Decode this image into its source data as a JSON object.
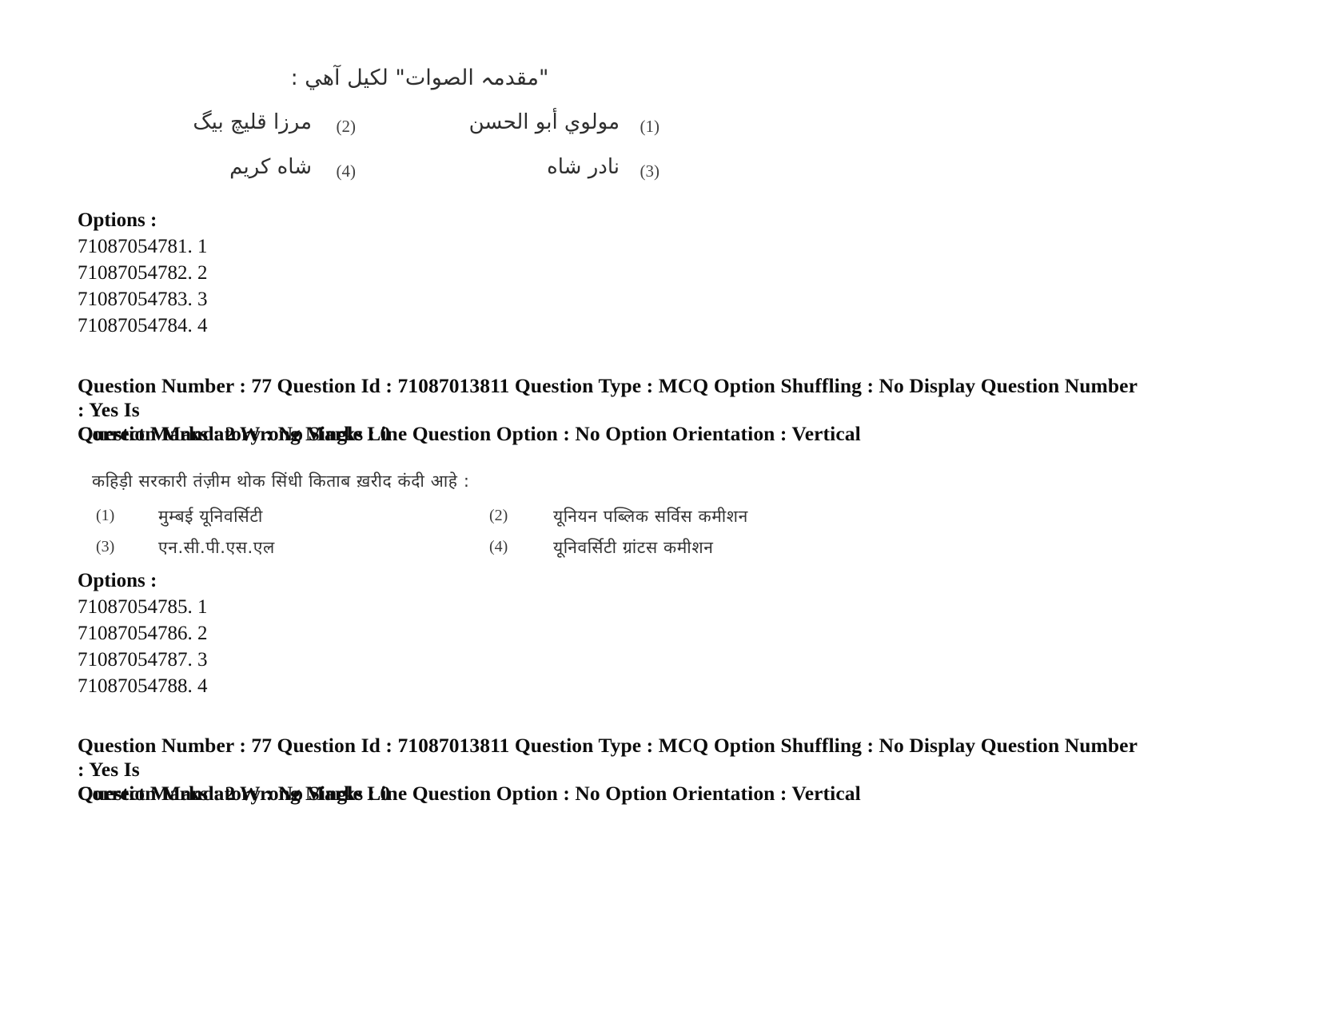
{
  "document": {
    "type": "exam-question-paper-scan",
    "background_color": "#ffffff",
    "text_color": "#111111"
  },
  "question_1": {
    "script": "sindhi-arabic",
    "stem": "\"مقدمہ الصوات\" لکيل آهي :",
    "options": [
      {
        "marker": "(1)",
        "text": "مولوي أبو الحسن"
      },
      {
        "marker": "(2)",
        "text": "مرزا قليچ بيگ"
      },
      {
        "marker": "(3)",
        "text": "نادر شاه"
      },
      {
        "marker": "(4)",
        "text": "شاه كريم"
      }
    ],
    "options_label": "Options :",
    "option_ids": [
      "71087054781. 1",
      "71087054782. 2",
      "71087054783. 3",
      "71087054784. 4"
    ]
  },
  "metadata_1": {
    "line1": "Question Number : 77 Question Id : 71087013811 Question Type : MCQ Option Shuffling : No Display Question Number : Yes Is",
    "line2": "Question Mandatory : No Single Line Question Option : No Option Orientation : Vertical",
    "marks": "Correct Marks : 2 Wrong Marks : 0"
  },
  "question_2": {
    "script": "sindhi-devanagari",
    "stem": "कहिड़ी सरकारी तंज़ीम थोक सिंधी किताब ख़रीद कंदी आहे :",
    "options": [
      {
        "marker": "(1)",
        "text": "मुम्बई यूनिवर्सिटी"
      },
      {
        "marker": "(2)",
        "text": "यूनियन पब्लिक सर्विस कमीशन"
      },
      {
        "marker": "(3)",
        "text": "एन.सी.पी.एस.एल"
      },
      {
        "marker": "(4)",
        "text": "यूनिवर्सिटी ग्रांटस कमीशन"
      }
    ],
    "options_label": "Options :",
    "option_ids": [
      "71087054785. 1",
      "71087054786. 2",
      "71087054787. 3",
      "71087054788. 4"
    ]
  },
  "metadata_2": {
    "line1": "Question Number : 77 Question Id : 71087013811 Question Type : MCQ Option Shuffling : No Display Question Number : Yes Is",
    "line2": "Question Mandatory : No Single Line Question Option : No Option Orientation : Vertical",
    "marks": "Correct Marks : 2 Wrong Marks : 0"
  }
}
